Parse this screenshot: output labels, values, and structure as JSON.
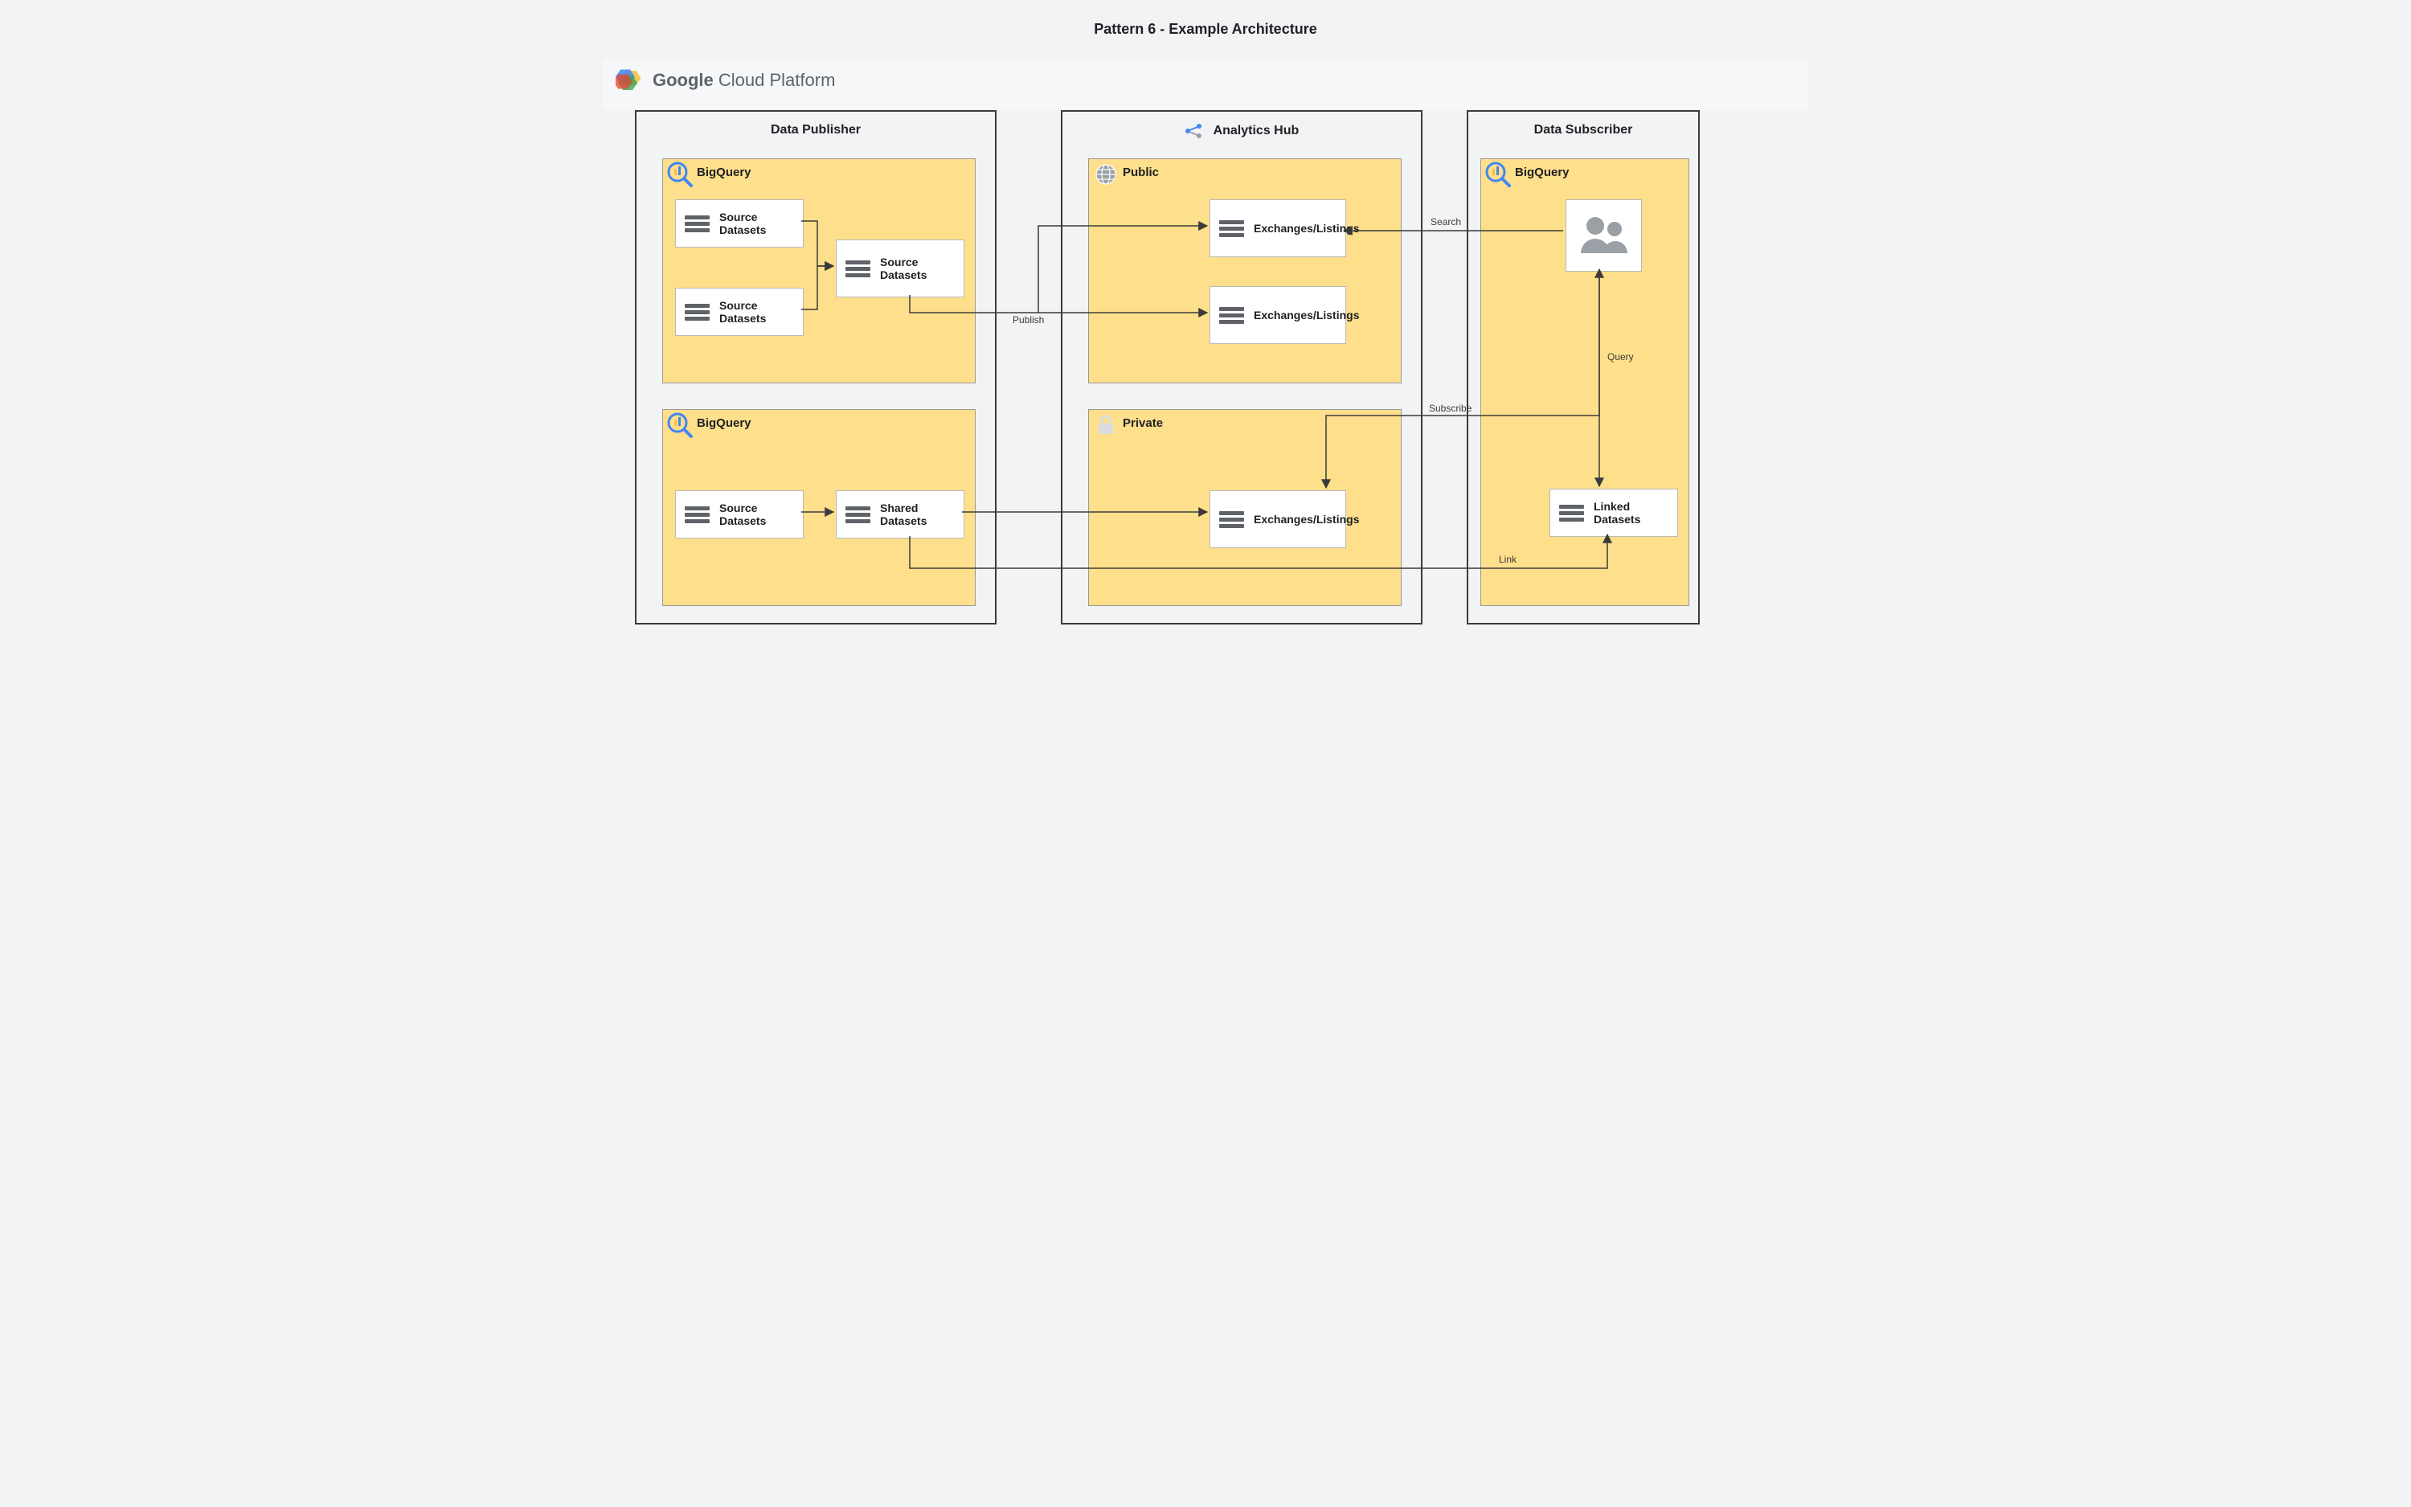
{
  "title": "Pattern 6 - Example Architecture",
  "brand": {
    "bold": "Google",
    "rest": " Cloud Platform"
  },
  "frames": {
    "publisher": {
      "title": "Data Publisher"
    },
    "hub": {
      "title": "Analytics Hub"
    },
    "subscriber": {
      "title": "Data Subscriber"
    }
  },
  "panels": {
    "bq1": {
      "label": "BigQuery"
    },
    "bq2": {
      "label": "BigQuery"
    },
    "public": {
      "label": "Public"
    },
    "private": {
      "label": "Private"
    },
    "bq3": {
      "label": "BigQuery"
    }
  },
  "cards": {
    "src1": "Source Datasets",
    "src2": "Source Datasets",
    "src3": "Source Datasets",
    "src4": "Source Datasets",
    "shared": "Shared Datasets",
    "exch1": "Exchanges/Listings",
    "exch2": "Exchanges/Listings",
    "exch3": "Exchanges/Listings",
    "linked": "Linked Datasets"
  },
  "edges": {
    "publish": "Publish",
    "search": "Search",
    "subscribe": "Subscribe",
    "query": "Query",
    "link": "Link"
  }
}
